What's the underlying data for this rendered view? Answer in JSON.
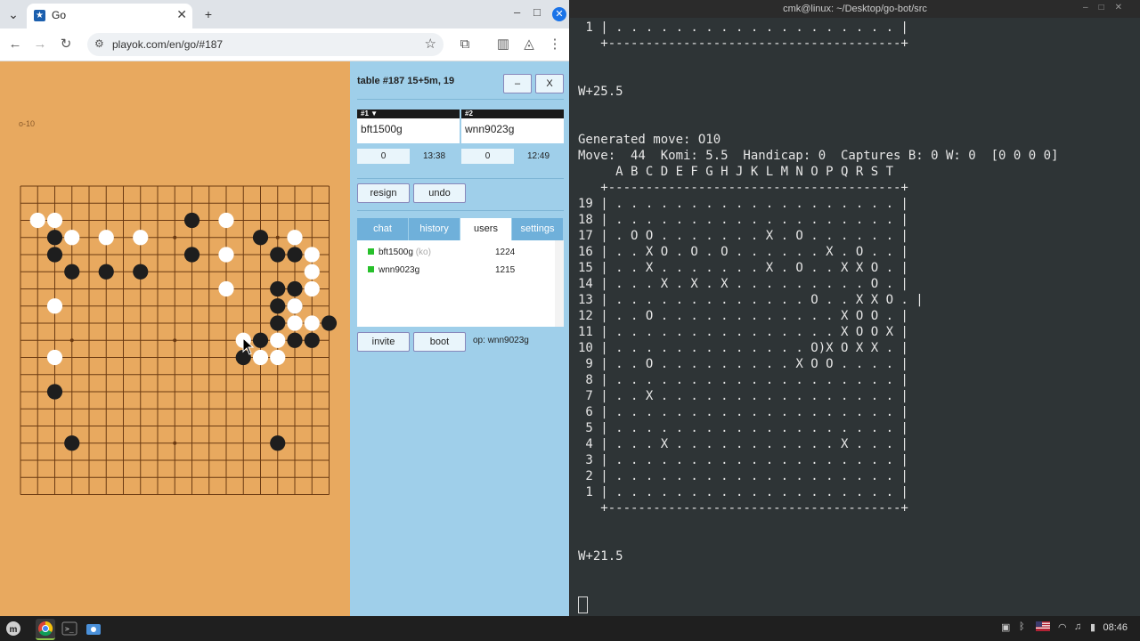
{
  "browser": {
    "tab_title": "Go",
    "url": "playok.com/en/go/#187"
  },
  "go_page": {
    "coord_label": "o-10",
    "table_title": "table #187   15+5m, 19",
    "minimize_label": "–",
    "close_label": "X",
    "players": [
      {
        "head": "#1 ▼",
        "name": "bft1500g",
        "score": "0",
        "clock": "13:38"
      },
      {
        "head": "#2",
        "name": "wnn9023g",
        "score": "0",
        "clock": "12:49"
      }
    ],
    "resign_label": "resign",
    "undo_label": "undo",
    "tabs": [
      {
        "label": "chat",
        "active": false
      },
      {
        "label": "history",
        "active": false
      },
      {
        "label": "users",
        "active": true
      },
      {
        "label": "settings",
        "active": false
      }
    ],
    "users": [
      {
        "name": "bft1500g",
        "tag": "(ko)",
        "rating": "1224"
      },
      {
        "name": "wnn9023g",
        "tag": "",
        "rating": "1215"
      }
    ],
    "invite_label": "invite",
    "boot_label": "boot",
    "op_label": "op: wnn9023g"
  },
  "board": {
    "size": 19,
    "colors": {
      "wood": "#e8a95f",
      "line": "#6b3a12",
      "black": "#1e1e1e",
      "white": "#ffffff"
    },
    "black": [
      [
        2,
        3
      ],
      [
        2,
        4
      ],
      [
        3,
        5
      ],
      [
        5,
        5
      ],
      [
        7,
        5
      ],
      [
        10,
        2
      ],
      [
        10,
        4
      ],
      [
        14,
        3
      ],
      [
        15,
        4
      ],
      [
        16,
        4
      ],
      [
        15,
        6
      ],
      [
        16,
        6
      ],
      [
        15,
        7
      ],
      [
        16,
        7
      ],
      [
        15,
        8
      ],
      [
        18,
        8
      ],
      [
        14,
        9
      ],
      [
        16,
        9
      ],
      [
        17,
        9
      ],
      [
        13,
        10
      ],
      [
        2,
        12
      ],
      [
        3,
        15
      ],
      [
        15,
        15
      ]
    ],
    "white": [
      [
        1,
        2
      ],
      [
        2,
        2
      ],
      [
        12,
        2
      ],
      [
        3,
        3
      ],
      [
        5,
        3
      ],
      [
        7,
        3
      ],
      [
        16,
        3
      ],
      [
        12,
        4
      ],
      [
        17,
        4
      ],
      [
        17,
        5
      ],
      [
        12,
        6
      ],
      [
        17,
        6
      ],
      [
        2,
        7
      ],
      [
        16,
        7
      ],
      [
        16,
        8
      ],
      [
        17,
        8
      ],
      [
        15,
        9
      ],
      [
        13,
        9
      ],
      [
        2,
        10
      ],
      [
        14,
        10
      ],
      [
        15,
        10
      ]
    ],
    "hoshi": [
      [
        3,
        3
      ],
      [
        9,
        3
      ],
      [
        15,
        3
      ],
      [
        3,
        9
      ],
      [
        9,
        9
      ],
      [
        15,
        9
      ],
      [
        3,
        15
      ],
      [
        9,
        15
      ],
      [
        15,
        15
      ]
    ]
  },
  "terminal": {
    "title": "cmk@linux: ~/Desktop/go-bot/src",
    "text": " 1 | . . . . . . . . . . . . . . . . . . . |\n   +---------------------------------------+\n\n\nW+25.5\n\n\nGenerated move: O10\nMove:  44  Komi: 5.5  Handicap: 0  Captures B: 0 W: 0  [0 0 0 0]\n     A B C D E F G H J K L M N O P Q R S T\n   +---------------------------------------+\n19 | . . . . . . . . . . . . . . . . . . . |\n18 | . . . . . . . . . . . . . . . . . . . |\n17 | . O O . . . . . . . X . O . . . . . . |\n16 | . . X O . O . O . . . . . . X . O . . |\n15 | . . X . . . . . . . X . O . . X X O . |\n14 | . . . X . X . X . . . . . . . . . O . |\n13 | . . . . . . . . . . . . . O . . X X O . |\n12 | . . O . . . . . . . . . . . . X O O . |\n11 | . . . . . . . . . . . . . . . X O O X |\n10 | . . . . . . . . . . . . . O)X O X X . |\n 9 | . . O . . . . . . . . . X O O . . . . |\n 8 | . . . . . . . . . . . . . . . . . . . |\n 7 | . . X . . . . . . . . . . . . . . . . |\n 6 | . . . . . . . . . . . . . . . . . . . |\n 5 | . . . . . . . . . . . . . . . . . . . |\n 4 | . . . X . . . . . . . . . . . X . . . |\n 3 | . . . . . . . . . . . . . . . . . . . |\n 2 | . . . . . . . . . . . . . . . . . . . |\n 1 | . . . . . . . . . . . . . . . . . . . |\n   +---------------------------------------+\n\n\nW+21.5"
  },
  "taskbar": {
    "clock": "08:46"
  }
}
